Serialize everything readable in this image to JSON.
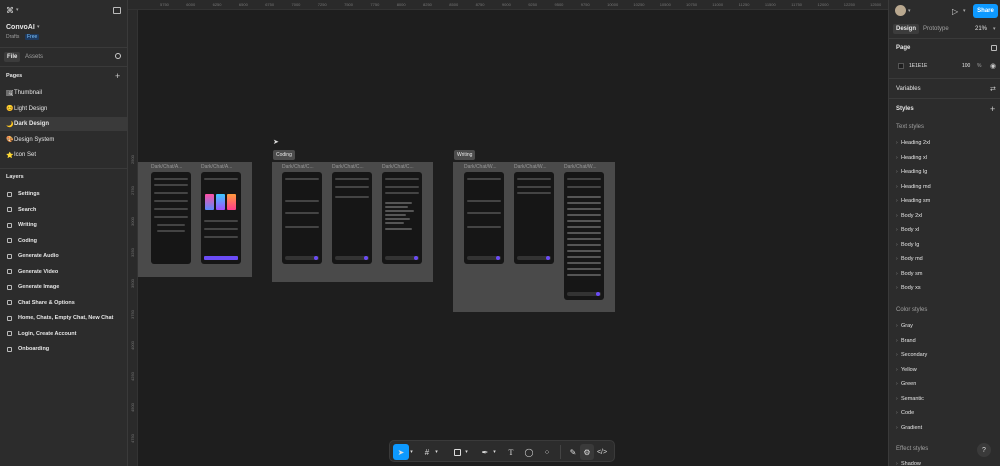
{
  "app": {
    "project_name": "ConvoAI",
    "location": "Drafts",
    "plan_badge": "Free"
  },
  "left_tabs": {
    "file": "File",
    "assets": "Assets"
  },
  "pages": {
    "header": "Pages",
    "items": [
      {
        "emoji": "🖼",
        "label": "Thumbnail"
      },
      {
        "emoji": "😊",
        "label": "Light Design"
      },
      {
        "emoji": "🌙",
        "label": "Dark Design"
      },
      {
        "emoji": "🎨",
        "label": "Design System"
      },
      {
        "emoji": "⭐",
        "label": "Icon Set"
      }
    ]
  },
  "layers": {
    "header": "Layers",
    "items": [
      "Settings",
      "Search",
      "Writing",
      "Coding",
      "Generate Audio",
      "Generate Video",
      "Generate Image",
      "Chat Share & Options",
      "Home, Chats, Empty Chat, New Chat",
      "Login, Create Account",
      "Onboarding"
    ]
  },
  "rulers": {
    "top": [
      "5750",
      "6000",
      "6250",
      "6500",
      "6750",
      "7000",
      "7250",
      "7500",
      "7750",
      "8000",
      "8250",
      "8500",
      "8750",
      "9000",
      "9250",
      "9500",
      "9750",
      "10000",
      "10250",
      "10500",
      "10750",
      "11000",
      "11250",
      "11500",
      "11750",
      "12000",
      "12250",
      "12500",
      "12750"
    ],
    "left": [
      "2500",
      "2750",
      "3000",
      "3250",
      "3500",
      "3750",
      "4000",
      "4250",
      "4500",
      "4750"
    ]
  },
  "canvas": {
    "sections": [
      {
        "label": "",
        "frames": [
          "Dark/Chat/A...",
          "Dark/Chat/A..."
        ]
      },
      {
        "label": "Coding",
        "frames": [
          "Dark/Chat/C...",
          "Dark/Chat/C...",
          "Dark/Chat/C..."
        ]
      },
      {
        "label": "Writing",
        "frames": [
          "Dark/Chat/W...",
          "Dark/Chat/W...",
          "Dark/Chat/W..."
        ]
      }
    ]
  },
  "right": {
    "tabs": {
      "design": "Design",
      "prototype": "Prototype"
    },
    "zoom": "21%",
    "share_label": "Share",
    "page": {
      "header": "Page",
      "color_hex": "1E1E1E",
      "opacity": "100",
      "opacity_unit": "%"
    },
    "variables_label": "Variables",
    "styles_header": "Styles",
    "text_styles": {
      "header": "Text styles",
      "items": [
        "Heading 2xl",
        "Heading xl",
        "Heading lg",
        "Heading md",
        "Heading sm",
        "Body 2xl",
        "Body xl",
        "Body lg",
        "Body md",
        "Body sm",
        "Body xs"
      ]
    },
    "color_styles": {
      "header": "Color styles",
      "items": [
        "Gray",
        "Brand",
        "Secondary",
        "Yellow",
        "Green",
        "Semantic",
        "Code",
        "Gradient"
      ]
    },
    "effect_styles": {
      "header": "Effect styles",
      "items": [
        "Shadow"
      ]
    }
  },
  "help_label": "?",
  "colors": {
    "accent": "#0d99ff",
    "brand_purple": "#6b4cf6",
    "canvas_bg": "#1e1e1e"
  }
}
